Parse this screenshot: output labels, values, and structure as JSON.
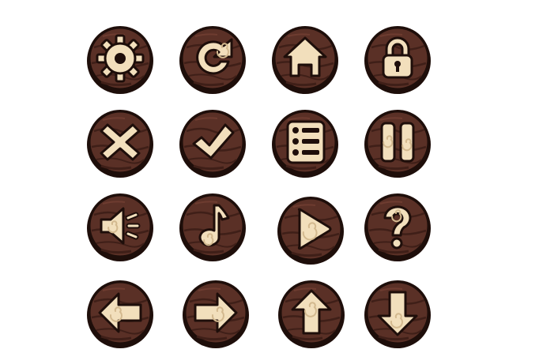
{
  "colors": {
    "outline": "#1e0e0a",
    "wood": "#5a3026",
    "wood_dark": "#3f1f18",
    "wood_light": "#6e3c30",
    "bone": "#f2dfbc",
    "bone_shade": "#d3b98f"
  },
  "buttons": [
    {
      "icon": "gear-icon"
    },
    {
      "icon": "restart-icon"
    },
    {
      "icon": "home-icon"
    },
    {
      "icon": "lock-icon"
    },
    {
      "icon": "close-icon"
    },
    {
      "icon": "check-icon"
    },
    {
      "icon": "menu-list-icon"
    },
    {
      "icon": "pause-icon"
    },
    {
      "icon": "sound-icon"
    },
    {
      "icon": "music-note-icon"
    },
    {
      "icon": "play-icon"
    },
    {
      "icon": "help-question-icon"
    },
    {
      "icon": "arrow-left-icon"
    },
    {
      "icon": "arrow-right-icon"
    },
    {
      "icon": "arrow-up-icon"
    },
    {
      "icon": "arrow-down-icon"
    }
  ]
}
